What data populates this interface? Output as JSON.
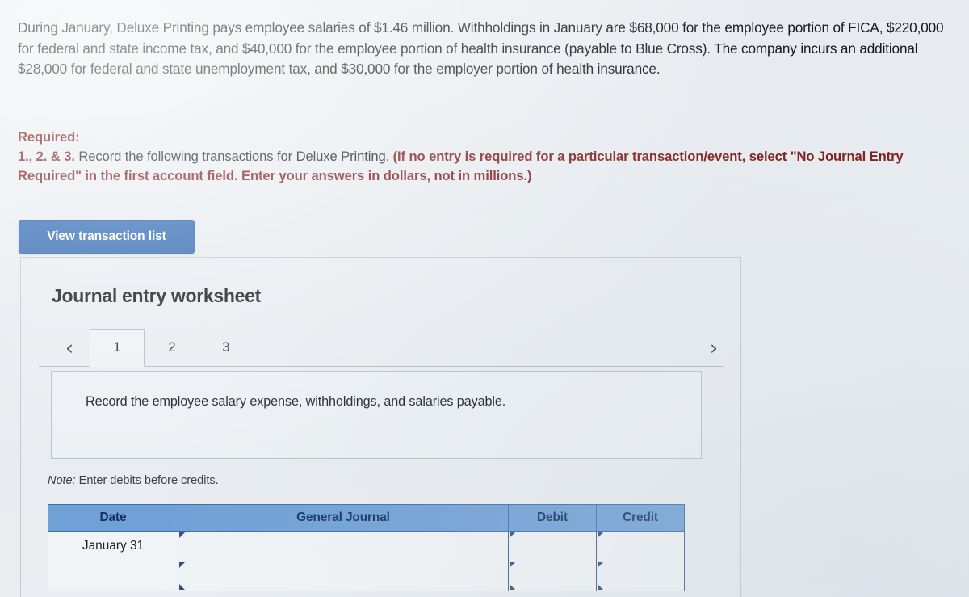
{
  "problem": {
    "text": "During January, Deluxe Printing pays employee salaries of $1.46 million. Withholdings in January are $68,000 for the employee portion of FICA, $220,000 for federal and state income tax, and $40,000 for the employee portion of health insurance (payable to Blue Cross). The company incurs an additional $28,000 for federal and state unemployment tax, and $30,000 for the employer portion of health insurance."
  },
  "required": {
    "label": "Required:",
    "numbering": "1., 2. & 3.",
    "instruction_plain": " Record the following transactions for Deluxe Printing. ",
    "instruction_bold": "(If no entry is required for a particular transaction/event, select \"No Journal Entry Required\" in the first account field. Enter your answers in dollars, not in millions.)"
  },
  "toolbar": {
    "view_transaction_list_label": "View transaction list"
  },
  "worksheet": {
    "title": "Journal entry worksheet",
    "prev_icon": "chevron-left-icon",
    "next_icon": "chevron-right-icon",
    "prev_glyph": "‹",
    "next_glyph": "›",
    "tabs": [
      {
        "label": "1",
        "active": true
      },
      {
        "label": "2",
        "active": false
      },
      {
        "label": "3",
        "active": false
      }
    ],
    "instruction": "Record the employee salary expense, withholdings, and salaries payable.",
    "note_prefix": "Note:",
    "note_text": " Enter debits before credits."
  },
  "journal_table": {
    "columns": [
      "Date",
      "General Journal",
      "Debit",
      "Credit"
    ],
    "rows": [
      {
        "date": "January 31",
        "general_journal": "",
        "debit": "",
        "credit": ""
      },
      {
        "date": "",
        "general_journal": "",
        "debit": "",
        "credit": ""
      }
    ]
  },
  "colors": {
    "button_blue": "#2d68b2",
    "table_header_blue": "#6fa0d6",
    "table_header_text": "#12305c",
    "required_red": "#7c1a1a",
    "page_background": "#e9edf0",
    "input_border": "#3c5f8c"
  }
}
